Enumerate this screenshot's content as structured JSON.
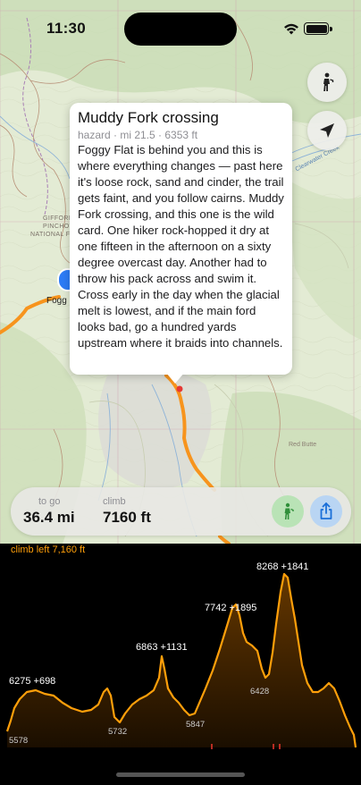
{
  "status_bar": {
    "time": "11:30"
  },
  "map": {
    "place_labels": [
      "GIFFORD",
      "PINCHOT",
      "NATIONAL F"
    ],
    "creek_label": "Clearwater Creek",
    "red_butte_label": "Red Butte",
    "current_place_label": "Fogg",
    "buttons": {
      "hiker_icon": "hiker-icon",
      "locate_icon": "location-arrow-icon"
    }
  },
  "callout": {
    "title": "Muddy Fork crossing",
    "meta": "hazard · mi 21.5 · 6353 ft",
    "body": "Foggy Flat is behind you and this is where everything changes — past here it's loose rock, sand and cinder, the trail gets faint, and you follow cairns. Muddy Fork crossing, and this one is the wild card. One hiker rock-hopped it dry at one fifteen in the afternoon on a sixty degree overcast day. Another had to throw his pack across and swim it. Cross early in the day when the glacial melt is lowest, and if the main ford looks bad, go a hundred yards upstream where it braids into channels."
  },
  "stats": {
    "to_go_label": "to go",
    "to_go_value": "36.4 mi",
    "climb_label": "climb",
    "climb_value": "7160 ft",
    "hike_button_icon": "hiker-icon",
    "share_button_icon": "share-icon"
  },
  "profile": {
    "header": "climb left 7,160 ft",
    "peak_labels": [
      {
        "elevation": 6275,
        "gain": "+698",
        "text": "6275  +698"
      },
      {
        "elevation": 6863,
        "gain": "+1131",
        "text": "6863  +1131"
      },
      {
        "elevation": 7742,
        "gain": "+1895",
        "text": "7742  +1895"
      },
      {
        "elevation": 8268,
        "gain": "+1841",
        "text": "8268  +1841"
      }
    ],
    "low_labels": [
      {
        "elevation": 5578,
        "text": "5578"
      },
      {
        "elevation": 5732,
        "text": "5732"
      },
      {
        "elevation": 5847,
        "text": "5847"
      },
      {
        "elevation": 6428,
        "text": "6428"
      }
    ],
    "colors": {
      "line": "#ff9f0a",
      "fill_top": "#5a3000",
      "fill_bottom": "#1a0d00",
      "marker": "#ff3b30"
    }
  }
}
